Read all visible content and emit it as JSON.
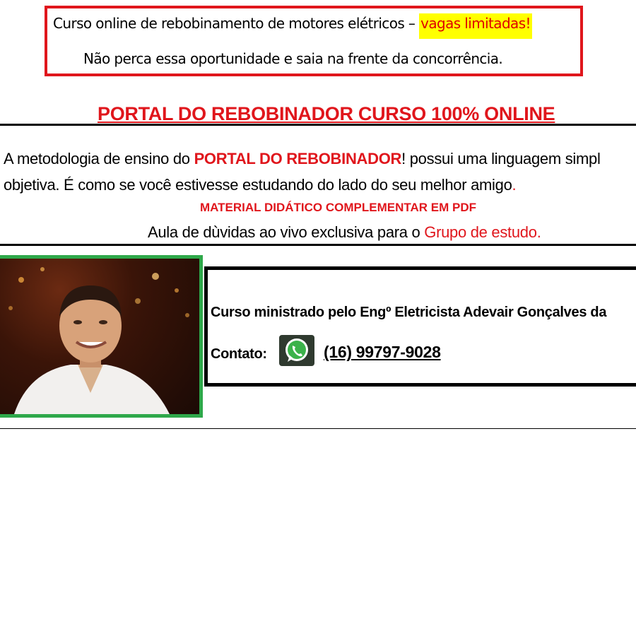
{
  "notice": {
    "line1_text": "Curso online de rebobinamento de motores elétricos – ",
    "line1_highlight": "vagas limitadas!",
    "line2": "Não perca essa oportunidade e saia na frente da concorrência."
  },
  "title": "PORTAL DO REBOBINADOR CURSO 100% ONLINE ",
  "description": {
    "line1_a": "A metodologia de ensino do ",
    "line1_brand": "PORTAL DO REBOBINADOR",
    "line1_b": "! possui uma linguagem simpl",
    "line2_a": "objetiva. É como se você estivesse estudando do lado do seu melhor amigo",
    "line2_period": "."
  },
  "material": "MATERIAL DIDÁTICO COMPLEMENTAR EM PDF",
  "aula": {
    "text": "Aula de dùvidas ao vivo exclusiva  para o ",
    "link": "Grupo de estudo",
    "period": "."
  },
  "instructor": {
    "text": "Curso ministrado pelo Engº Eletricista Adevair Gonçalves da",
    "contact_label": "Contato:",
    "phone": "(16) 99797-9028",
    "contact_icon": "whatsapp-icon"
  },
  "colors": {
    "accent_red": "#e0161c",
    "highlight_yellow": "#ffff00",
    "photo_border_green": "#2ea84a"
  }
}
